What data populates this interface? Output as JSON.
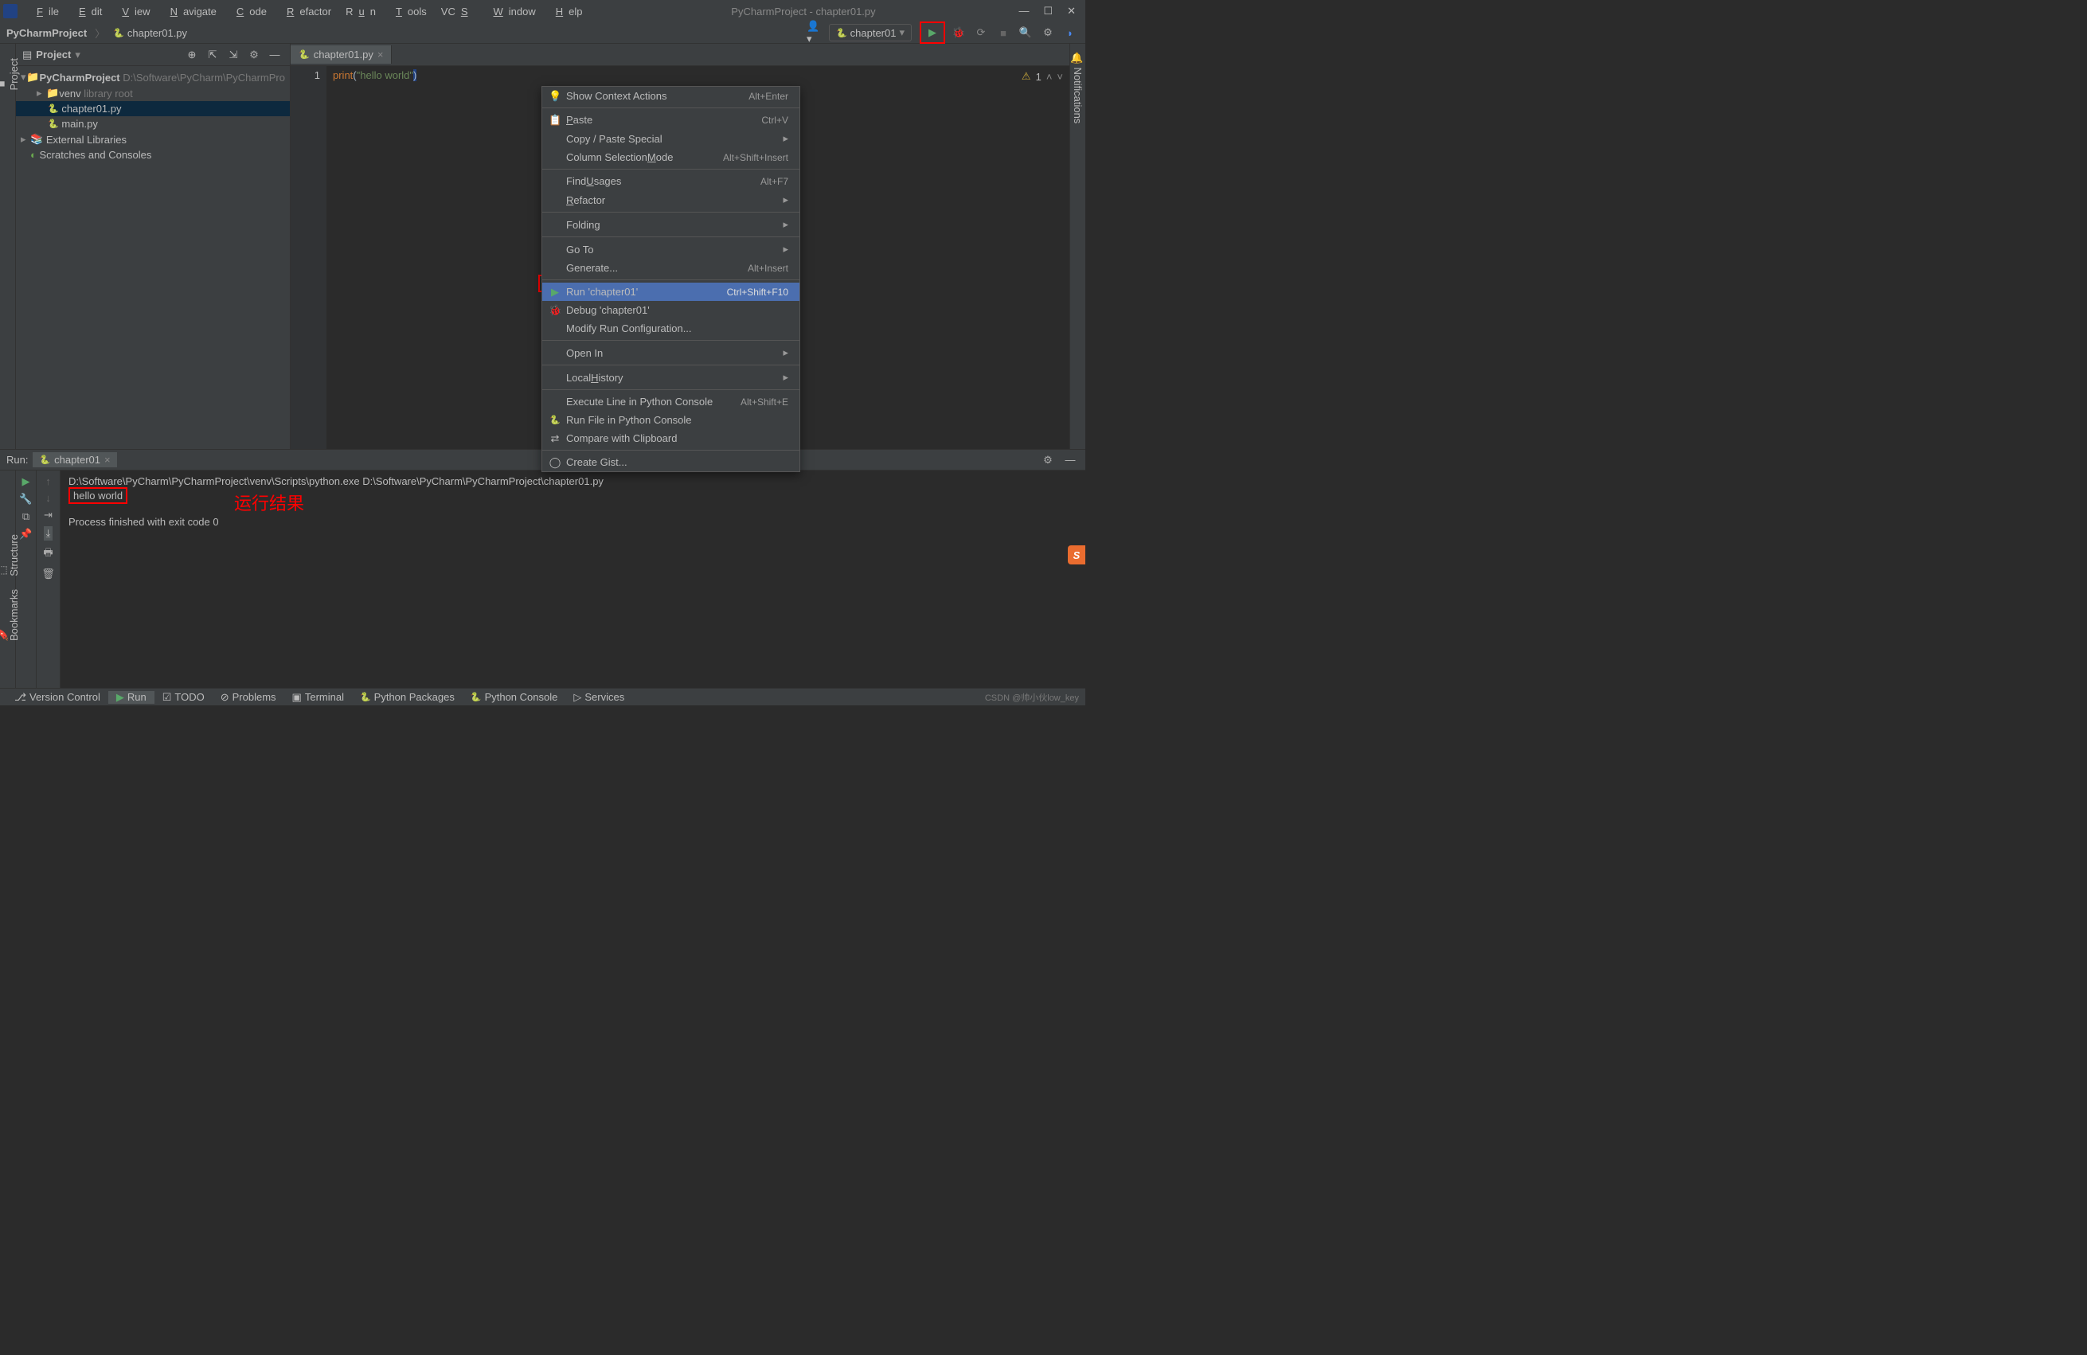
{
  "window": {
    "title": "PyCharmProject - chapter01.py"
  },
  "menubar": [
    "File",
    "Edit",
    "View",
    "Navigate",
    "Code",
    "Refactor",
    "Run",
    "Tools",
    "VCS",
    "Window",
    "Help"
  ],
  "breadcrumb": {
    "project": "PyCharmProject",
    "file": "chapter01.py"
  },
  "run_config": {
    "name": "chapter01"
  },
  "project_panel": {
    "header": "Project",
    "root_name": "PyCharmProject",
    "root_path": "D:\\Software\\PyCharm\\PyCharmPro",
    "venv": "venv",
    "venv_note": "library root",
    "file1": "chapter01.py",
    "file2": "main.py",
    "ext_lib": "External Libraries",
    "scratches": "Scratches and Consoles"
  },
  "tab": {
    "name": "chapter01.py"
  },
  "code": {
    "line_no": "1",
    "fn": "print",
    "open": "(",
    "str": "\"hello world\"",
    "close": ")"
  },
  "editor_status": {
    "warn": "1"
  },
  "context_menu": {
    "show_actions": {
      "label": "Show Context Actions",
      "sc": "Alt+Enter"
    },
    "paste": {
      "label": "Paste",
      "sc": "Ctrl+V"
    },
    "paste_special": {
      "label": "Copy / Paste Special"
    },
    "col_sel": {
      "label": "Column Selection Mode",
      "sc": "Alt+Shift+Insert"
    },
    "find_usages": {
      "label": "Find Usages",
      "sc": "Alt+F7"
    },
    "refactor": {
      "label": "Refactor"
    },
    "folding": {
      "label": "Folding"
    },
    "goto": {
      "label": "Go To"
    },
    "generate": {
      "label": "Generate...",
      "sc": "Alt+Insert"
    },
    "run": {
      "label": "Run 'chapter01'",
      "sc": "Ctrl+Shift+F10"
    },
    "debug": {
      "label": "Debug 'chapter01'"
    },
    "modify": {
      "label": "Modify Run Configuration..."
    },
    "open_in": {
      "label": "Open In"
    },
    "local_hist": {
      "label": "Local History"
    },
    "exec_line": {
      "label": "Execute Line in Python Console",
      "sc": "Alt+Shift+E"
    },
    "run_console": {
      "label": "Run File in Python Console"
    },
    "compare": {
      "label": "Compare with Clipboard"
    },
    "gist": {
      "label": "Create Gist..."
    }
  },
  "run_panel": {
    "title": "Run:",
    "tab": "chapter01",
    "cmd": "D:\\Software\\PyCharm\\PyCharmProject\\venv\\Scripts\\python.exe D:\\Software\\PyCharm\\PyCharmProject\\chapter01.py",
    "output": "hello world",
    "annotation": "运行结果",
    "exit": "Process finished with exit code 0"
  },
  "status_items": {
    "vcs": "Version Control",
    "run": "Run",
    "todo": "TODO",
    "problems": "Problems",
    "terminal": "Terminal",
    "packages": "Python Packages",
    "console": "Python Console",
    "services": "Services",
    "credit": "CSDN @帅小伙low_key"
  },
  "left_tabs": {
    "proj": "Project",
    "struct": "Structure",
    "bookmarks": "Bookmarks"
  },
  "right_tabs": {
    "notif": "Notifications"
  }
}
